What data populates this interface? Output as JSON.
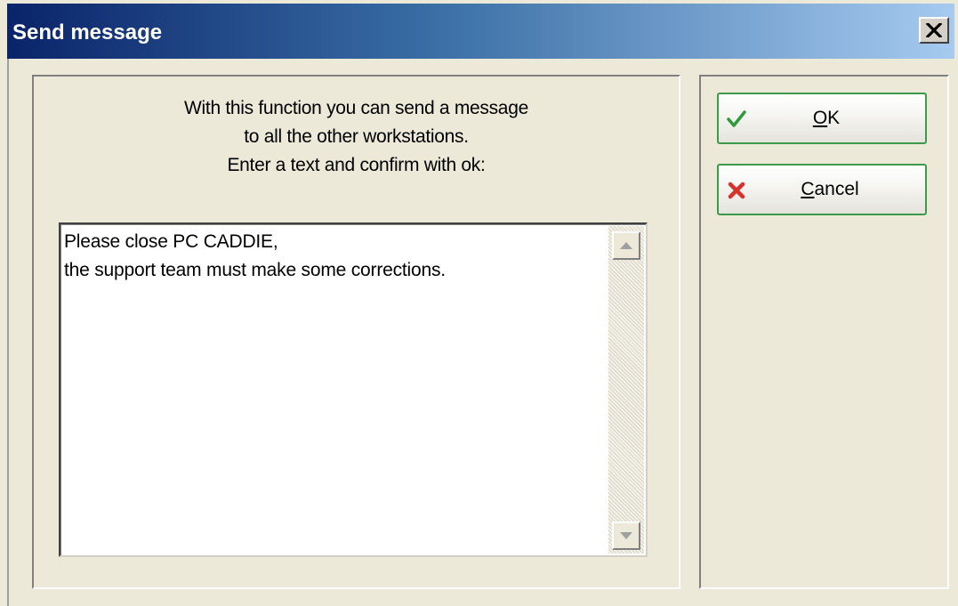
{
  "window": {
    "title": "Send message"
  },
  "instructions": {
    "line1": "With this function you can send a message",
    "line2": "to all the other workstations.",
    "line3": "Enter a text and confirm with ok:"
  },
  "message": {
    "line1": "Please close PC CADDIE,",
    "line2": "the support team must make some corrections."
  },
  "buttons": {
    "ok": {
      "accel": "O",
      "rest": "K",
      "icon": "checkmark-icon",
      "color": "#3c9a4a"
    },
    "cancel": {
      "accel": "C",
      "rest": "ancel",
      "icon": "cross-icon",
      "color": "#d8322a"
    }
  },
  "colors": {
    "titlebar_start": "#0a246a",
    "titlebar_end": "#a6caf0",
    "button_border": "#3c9a4a"
  }
}
